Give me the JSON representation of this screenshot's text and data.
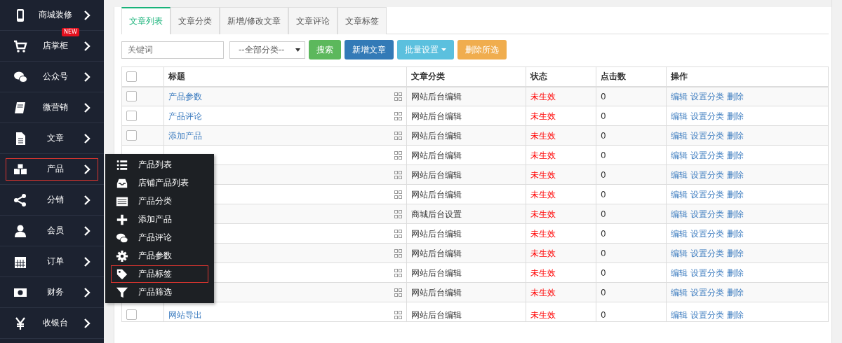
{
  "sidebar": {
    "items": [
      {
        "label": "商城装修",
        "selected": false
      },
      {
        "label": "店掌柜",
        "selected": false,
        "badge": "NEW"
      },
      {
        "label": "公众号",
        "selected": false
      },
      {
        "label": "微营销",
        "selected": false
      },
      {
        "label": "文章",
        "selected": false
      },
      {
        "label": "产品",
        "selected": true
      },
      {
        "label": "分销",
        "selected": false
      },
      {
        "label": "会员",
        "selected": false
      },
      {
        "label": "订单",
        "selected": false
      },
      {
        "label": "财务",
        "selected": false
      },
      {
        "label": "收银台",
        "selected": false
      }
    ]
  },
  "flyout_menu": {
    "items": [
      {
        "label": "产品列表",
        "selected": false
      },
      {
        "label": "店铺产品列表",
        "selected": false
      },
      {
        "label": "产品分类",
        "selected": false
      },
      {
        "label": "添加产品",
        "selected": false
      },
      {
        "label": "产品评论",
        "selected": false
      },
      {
        "label": "产品参数",
        "selected": false
      },
      {
        "label": "产品标签",
        "selected": true
      },
      {
        "label": "产品筛选",
        "selected": false
      }
    ]
  },
  "tabs": [
    {
      "label": "文章列表",
      "selected": true
    },
    {
      "label": "文章分类",
      "selected": false
    },
    {
      "label": "新增/修改文章",
      "selected": false
    },
    {
      "label": "文章评论",
      "selected": false
    },
    {
      "label": "文章标签",
      "selected": false
    }
  ],
  "toolbar": {
    "search": {
      "placeholder": "关键词"
    },
    "category_select": {
      "value": "--全部分类--"
    },
    "buttons": [
      {
        "label": "搜索",
        "kind": "success"
      },
      {
        "label": "新增文章",
        "kind": "primary"
      },
      {
        "label": "批量设置",
        "kind": "info",
        "dropdown": true
      },
      {
        "label": "删除所选",
        "kind": "warning"
      }
    ]
  },
  "table": {
    "select_all_checked": false,
    "columns": [
      "标题",
      "文章分类",
      "状态",
      "点击数",
      "操作"
    ],
    "rows": [
      {
        "checked": false,
        "title": "产品参数",
        "category": "网站后台编辑",
        "status": "未生效",
        "clicks": "0",
        "actions": [
          "编辑",
          "设置分类",
          "删除"
        ]
      },
      {
        "checked": false,
        "title": "产品评论",
        "category": "网站后台编辑",
        "status": "未生效",
        "clicks": "0",
        "actions": [
          "编辑",
          "设置分类",
          "删除"
        ]
      },
      {
        "checked": false,
        "title": "添加产品",
        "category": "网站后台编辑",
        "status": "未生效",
        "clicks": "0",
        "actions": [
          "编辑",
          "设置分类",
          "删除"
        ]
      },
      {
        "category": "网站后台编辑",
        "status": "未生效",
        "clicks": "0",
        "actions": [
          "编辑",
          "设置分类",
          "删除"
        ]
      },
      {
        "category": "网站后台编辑",
        "status": "未生效",
        "clicks": "0",
        "actions": [
          "编辑",
          "设置分类",
          "删除"
        ]
      },
      {
        "category": "网站后台编辑",
        "status": "未生效",
        "clicks": "0",
        "actions": [
          "编辑",
          "设置分类",
          "删除"
        ]
      },
      {
        "category": "商城后台设置",
        "status": "未生效",
        "clicks": "0",
        "actions": [
          "编辑",
          "设置分类",
          "删除"
        ]
      },
      {
        "category": "网站后台编辑",
        "status": "未生效",
        "clicks": "0",
        "actions": [
          "编辑",
          "设置分类",
          "删除"
        ]
      },
      {
        "category": "网站后台编辑",
        "status": "未生效",
        "clicks": "0",
        "actions": [
          "编辑",
          "设置分类",
          "删除"
        ]
      },
      {
        "category": "网站后台编辑",
        "status": "未生效",
        "clicks": "0",
        "actions": [
          "编辑",
          "设置分类",
          "删除"
        ]
      },
      {
        "category": "网站后台编辑",
        "status": "未生效",
        "clicks": "0",
        "actions": [
          "编辑",
          "设置分类",
          "删除"
        ]
      },
      {
        "checked": false,
        "title": "网站导出",
        "category": "网站后台编辑",
        "status": "未生效",
        "clicks": "0",
        "actions": [
          "编辑",
          "设置分类",
          "删除"
        ]
      }
    ]
  }
}
